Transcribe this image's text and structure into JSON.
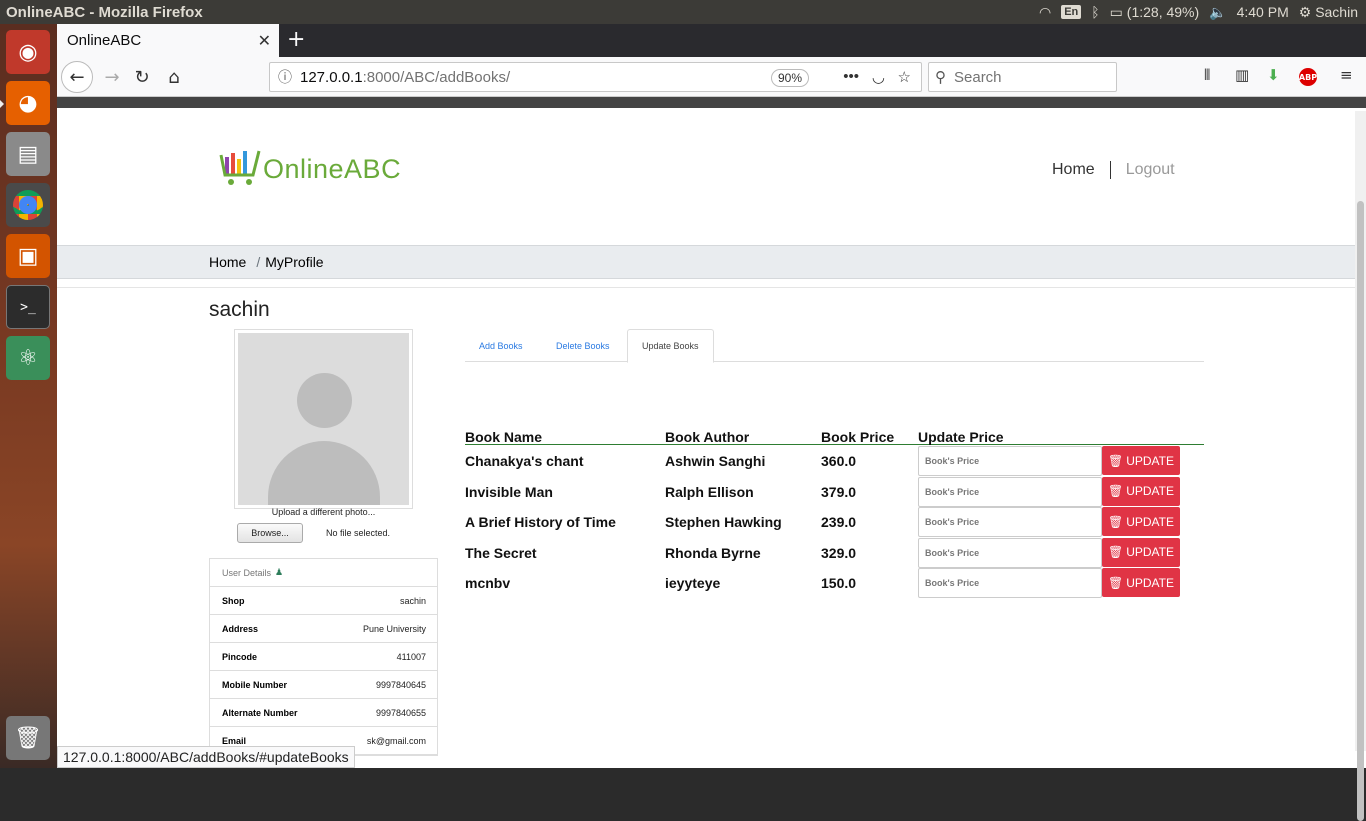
{
  "os": {
    "window_title": "OnlineABC - Mozilla Firefox",
    "keyboard": "En",
    "battery": "(1:28, 49%)",
    "time": "4:40 PM",
    "user": "Sachin"
  },
  "browser": {
    "tab_title": "OnlineABC",
    "url_host": "127.0.0.1",
    "url_path": ":8000/ABC/addBooks/",
    "zoom": "90%",
    "search_placeholder": "Search",
    "status_url": "127.0.0.1:8000/ABC/addBooks/#updateBooks"
  },
  "site": {
    "brand": "OnlineABC",
    "nav": {
      "home": "Home",
      "logout": "Logout"
    },
    "breadcrumb": {
      "home": "Home",
      "current": "MyProfile",
      "separator": "/"
    }
  },
  "profile": {
    "username": "sachin",
    "upload_label": "Upload a different photo...",
    "browse_label": "Browse...",
    "no_file": "No file selected.",
    "details_title": "User Details",
    "details": [
      {
        "key": "Shop",
        "value": "sachin"
      },
      {
        "key": "Address",
        "value": "Pune University"
      },
      {
        "key": "Pincode",
        "value": "411007"
      },
      {
        "key": "Mobile Number",
        "value": "9997840645"
      },
      {
        "key": "Alternate Number",
        "value": "9997840655"
      },
      {
        "key": "Email",
        "value": "sk@gmail.com"
      }
    ]
  },
  "tabs": [
    {
      "label": "Add Books",
      "active": false
    },
    {
      "label": "Delete Books",
      "active": false
    },
    {
      "label": "Update Books",
      "active": true
    }
  ],
  "table": {
    "headers": [
      "Book Name",
      "Book Author",
      "Book Price",
      "Update Price"
    ],
    "input_placeholder": "Book's Price",
    "button_label": "UPDATE",
    "rows": [
      {
        "name": "Chanakya's chant",
        "author": "Ashwin Sanghi",
        "price": "360.0"
      },
      {
        "name": "Invisible Man",
        "author": "Ralph Ellison",
        "price": "379.0"
      },
      {
        "name": "A Brief History of Time",
        "author": "Stephen Hawking",
        "price": "239.0"
      },
      {
        "name": "The Secret",
        "author": "Rhonda Byrne",
        "price": "329.0"
      },
      {
        "name": "mcnbv",
        "author": "ieyyteye",
        "price": "150.0"
      }
    ]
  },
  "colors": {
    "accent_green": "#6aaa3a",
    "update_button": "#e03445",
    "tab_link": "#2a7ae2"
  }
}
